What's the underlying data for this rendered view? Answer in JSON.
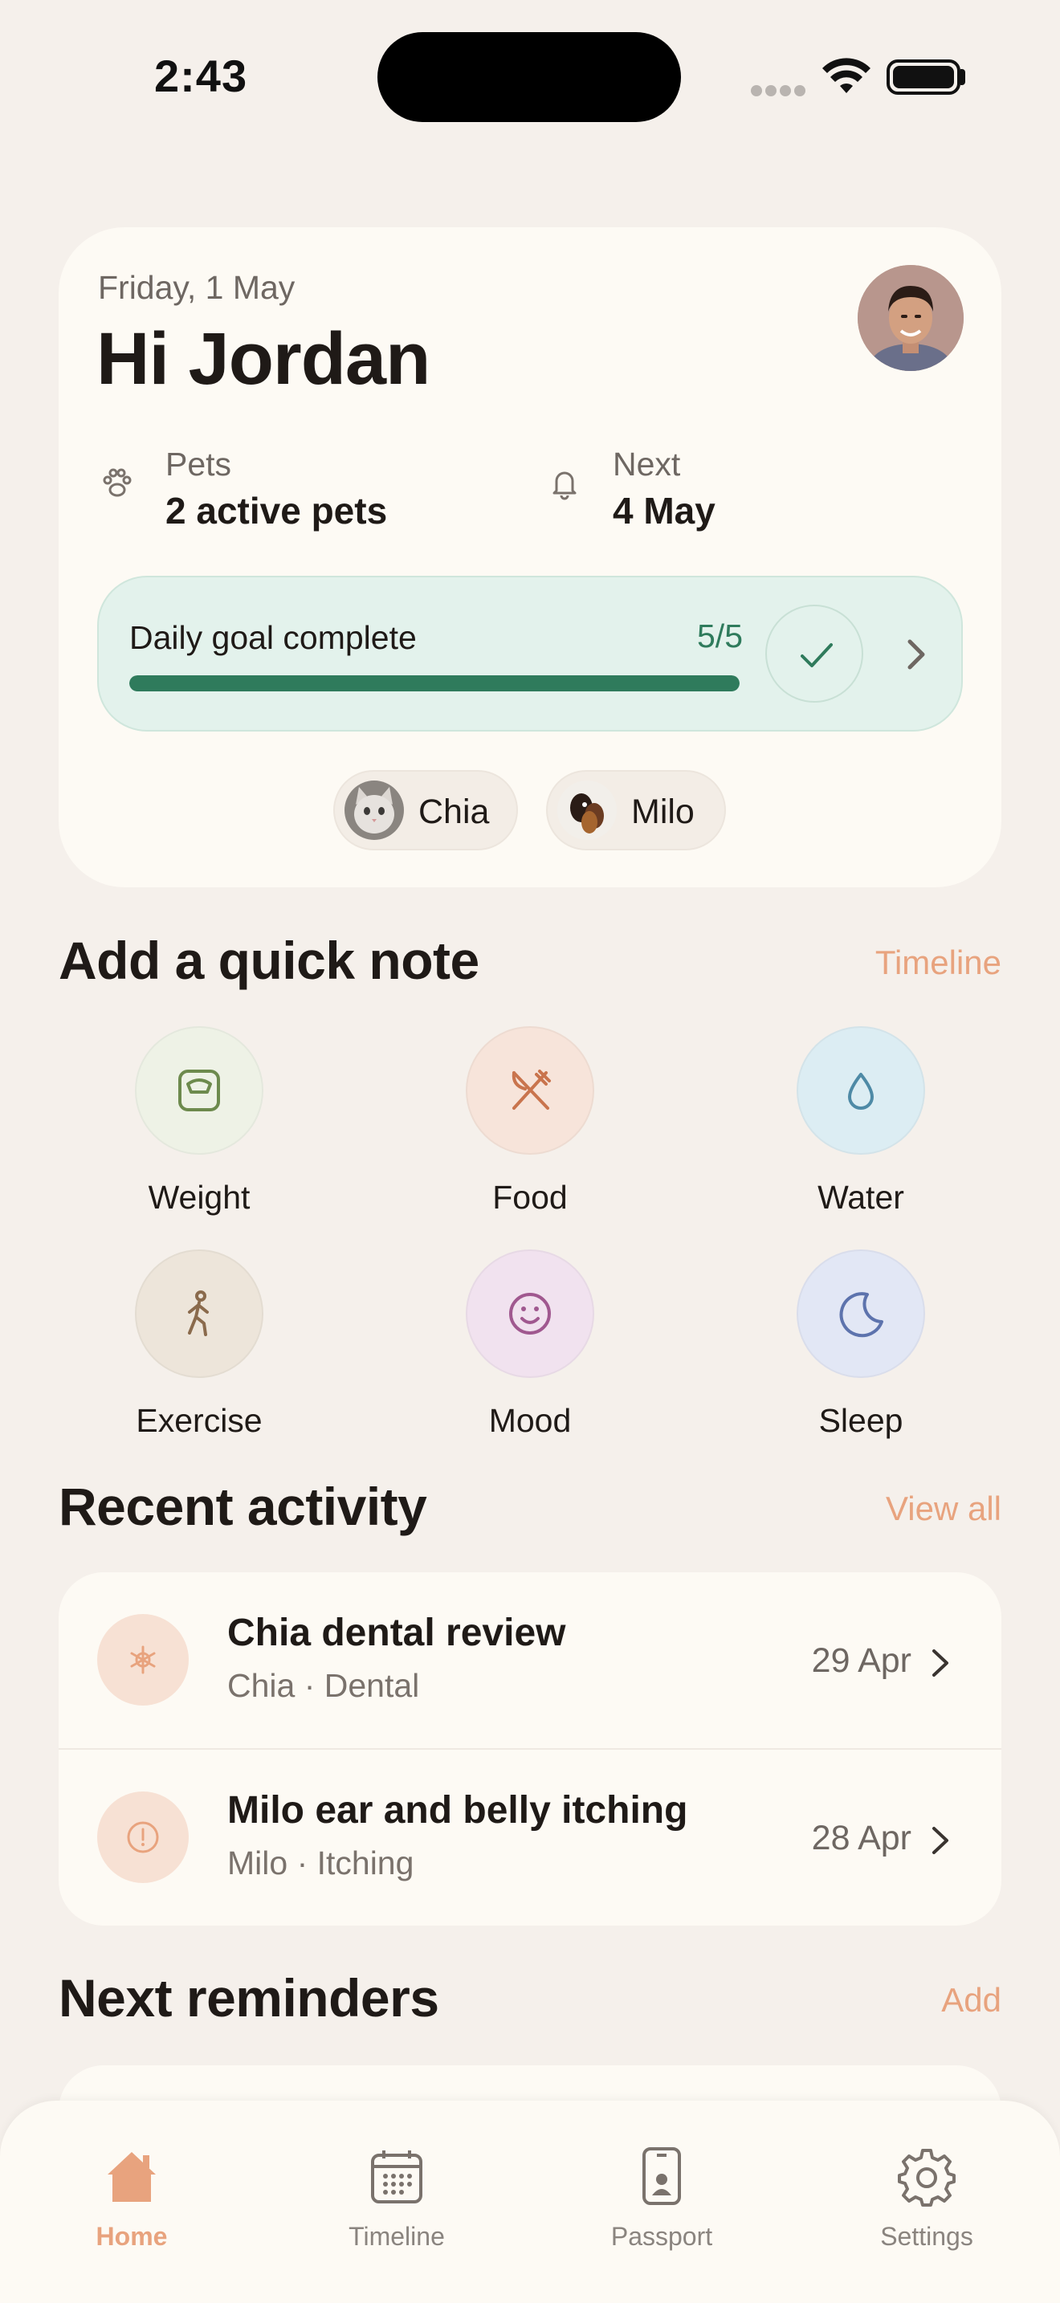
{
  "status_bar": {
    "time": "2:43"
  },
  "header": {
    "date": "Friday, 1 May",
    "greeting": "Hi Jordan",
    "pets_label": "Pets",
    "pets_value": "2 active pets",
    "next_label": "Next",
    "next_value": "4 May"
  },
  "daily_goal": {
    "label": "Daily goal complete",
    "count": "5/5",
    "progress_fraction": 1.0
  },
  "pets": [
    {
      "name": "Chia"
    },
    {
      "name": "Milo"
    }
  ],
  "quick_note": {
    "title": "Add a quick note",
    "link": "Timeline",
    "items": [
      {
        "label": "Weight",
        "icon": "scale-icon",
        "bg": "#eef2e6",
        "color": "#6d8a4d"
      },
      {
        "label": "Food",
        "icon": "fork-knife-icon",
        "bg": "#f7e4da",
        "color": "#c9744d"
      },
      {
        "label": "Water",
        "icon": "droplet-icon",
        "bg": "#dcedf3",
        "color": "#4e8aa6"
      },
      {
        "label": "Exercise",
        "icon": "walking-icon",
        "bg": "#ede5da",
        "color": "#8a6a4c"
      },
      {
        "label": "Mood",
        "icon": "smile-icon",
        "bg": "#f1e2ef",
        "color": "#a0588f"
      },
      {
        "label": "Sleep",
        "icon": "moon-icon",
        "bg": "#e2e7f5",
        "color": "#5d73ad"
      }
    ]
  },
  "recent_activity": {
    "title": "Recent activity",
    "link": "View all",
    "items": [
      {
        "title": "Chia dental review",
        "subtitle": "Chia · Dental",
        "date": "29 Apr",
        "icon": "asterisk-icon"
      },
      {
        "title": "Milo ear and belly itching",
        "subtitle": "Milo · Itching",
        "date": "28 Apr",
        "icon": "alert-circle-icon"
      }
    ]
  },
  "reminders": {
    "title": "Next reminders",
    "link": "Add"
  },
  "tabbar": {
    "tabs": [
      {
        "label": "Home",
        "icon": "home-icon",
        "active": true
      },
      {
        "label": "Timeline",
        "icon": "calendar-icon",
        "active": false
      },
      {
        "label": "Passport",
        "icon": "passport-icon",
        "active": false
      },
      {
        "label": "Settings",
        "icon": "gear-icon",
        "active": false
      }
    ]
  },
  "colors": {
    "background": "#f5f0eb",
    "card": "#fdfaf4",
    "accent": "#e8a37e",
    "goal_green": "#2f7b5c",
    "goal_bg": "#e3f2ec"
  }
}
